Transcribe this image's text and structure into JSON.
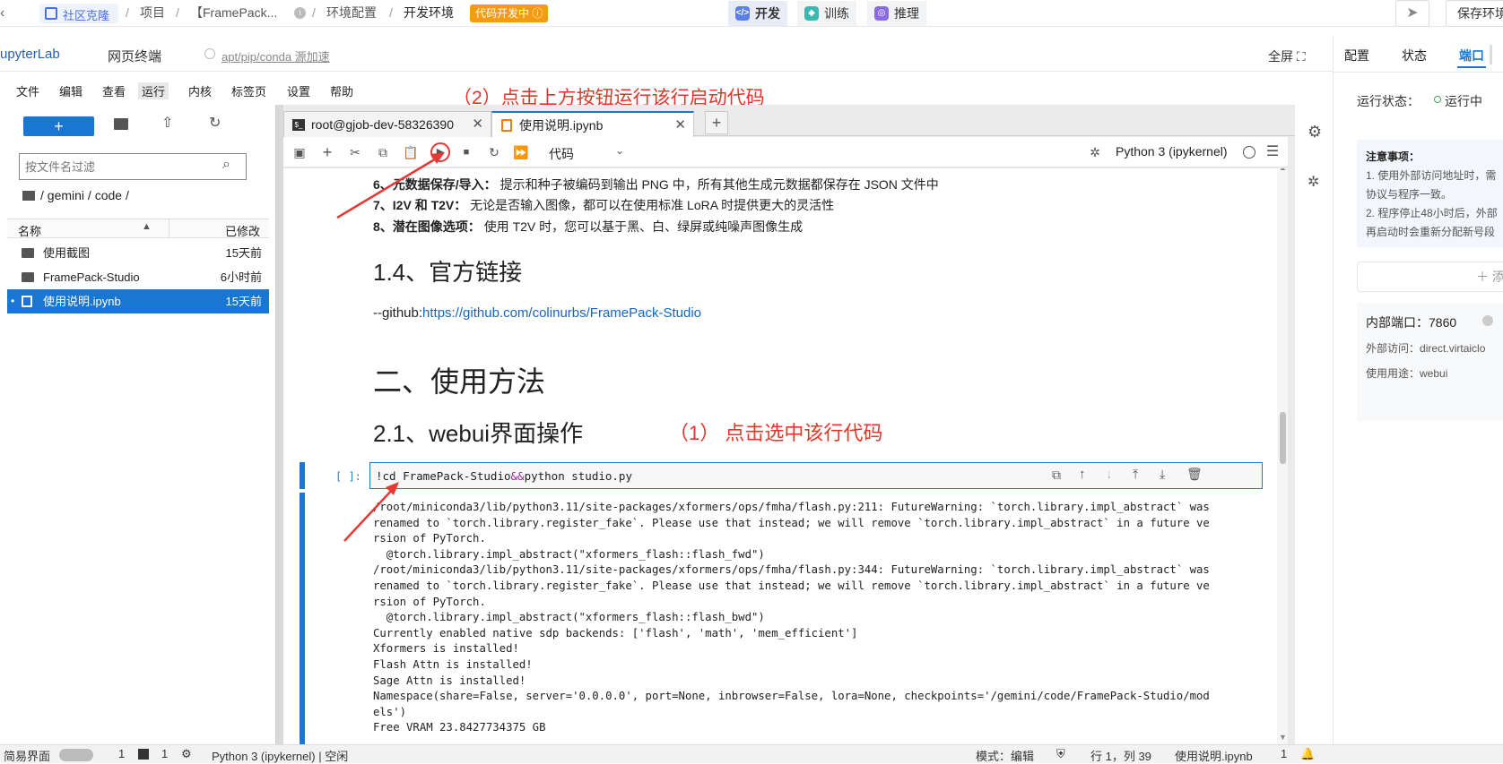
{
  "topbar": {
    "community_clone": "社区克隆",
    "project": "项目",
    "project_name": "【FramePack...",
    "env_config": "环境配置",
    "dev_env": "开发环境",
    "status_badge": "代码开发中",
    "tabs": [
      "开发",
      "训练",
      "推理"
    ],
    "save_env": "保存环境"
  },
  "bar2": {
    "jupyterlab": "upyterLab",
    "web_terminal": "网页终端",
    "mirror_link": "apt/pip/conda 源加速",
    "fullscreen": "全屏",
    "right_tabs": [
      "配置",
      "状态",
      "端口"
    ]
  },
  "menu": [
    "文件",
    "编辑",
    "查看",
    "运行",
    "内核",
    "标签页",
    "设置",
    "帮助"
  ],
  "annotation2": "（2）点击上方按钮运行该行启动代码",
  "annotation1": "（1） 点击选中该行代码",
  "filebrowser": {
    "filter_placeholder": "按文件名过滤",
    "path": "/ gemini / code /",
    "col_name": "名称",
    "col_modified": "已修改",
    "files": [
      {
        "name": "使用截图",
        "modified": "15天前"
      },
      {
        "name": "FramePack-Studio",
        "modified": "6小时前"
      },
      {
        "name": "使用说明.ipynb",
        "modified": "15天前"
      }
    ]
  },
  "doctabs": [
    "root@gjob-dev-58326390",
    "使用说明.ipynb"
  ],
  "toolbar": {
    "cell_type": "代码",
    "kernel": "Python 3 (ipykernel)"
  },
  "notebook": {
    "item6_bold": "6、元数据保存/导入：",
    "item6": "提示和种子被编码到输出 PNG 中，所有其他生成元数据都保存在 JSON 文件中",
    "item7_bold": "7、I2V 和 T2V：",
    "item7": "无论是否输入图像，都可以在使用标准 LoRA 时提供更大的灵活性",
    "item8_bold": "8、潜在图像选项：",
    "item8": "使用 T2V 时，您可以基于黑、白、绿屏或纯噪声图像生成",
    "h_links": "1.4、官方链接",
    "github_prefix": "--github:",
    "github_url": "https://github.com/colinurbs/FramePack-Studio",
    "h_usage": "二、使用方法",
    "h_webui": "2.1、webui界面操作",
    "cell_prompt": "[ ]:",
    "cell_code_a": "!cd FramePack-Studio",
    "cell_code_op": "&&",
    "cell_code_b": "python studio.py",
    "output": [
      "/root/miniconda3/lib/python3.11/site-packages/xformers/ops/fmha/flash.py:211: FutureWarning: `torch.library.impl_abstract` was",
      "renamed to `torch.library.register_fake`. Please use that instead; we will remove `torch.library.impl_abstract` in a future ve",
      "rsion of PyTorch.",
      "  @torch.library.impl_abstract(\"xformers_flash::flash_fwd\")",
      "/root/miniconda3/lib/python3.11/site-packages/xformers/ops/fmha/flash.py:344: FutureWarning: `torch.library.impl_abstract` was",
      "renamed to `torch.library.register_fake`. Please use that instead; we will remove `torch.library.impl_abstract` in a future ve",
      "rsion of PyTorch.",
      "  @torch.library.impl_abstract(\"xformers_flash::flash_bwd\")",
      "Currently enabled native sdp backends: ['flash', 'math', 'mem_efficient']",
      "Xformers is installed!",
      "Flash Attn is installed!",
      "Sage Attn is installed!",
      "Namespace(share=False, server='0.0.0.0', port=None, inbrowser=False, lora=None, checkpoints='/gemini/code/FramePack-Studio/mod",
      "els')",
      "Free VRAM 23.8427734375 GB"
    ]
  },
  "rpanel": {
    "run_status_label": "运行状态：",
    "run_status": "运行中",
    "notice_title": "注意事项：",
    "notice_lines": [
      "1. 使用外部访问地址时，需",
      "协议与程序一致。",
      "2. 程序停止48小时后，外部",
      "再启动时会重新分配新号段"
    ],
    "add_label": "添",
    "internal_port_label": "内部端口：",
    "internal_port": "7860",
    "external_label": "外部访问：",
    "external_value": "direct.virtaiclo",
    "purpose_label": "使用用途：",
    "purpose_value": "webui"
  },
  "statusbar": {
    "simple_mode": "简易界面",
    "count1": "1",
    "count2": "1",
    "kernel_status": "Python 3 (ipykernel) | 空闲",
    "mode": "模式：编辑",
    "position": "行 1，列 39",
    "filename": "使用说明.ipynb",
    "num": "1"
  }
}
